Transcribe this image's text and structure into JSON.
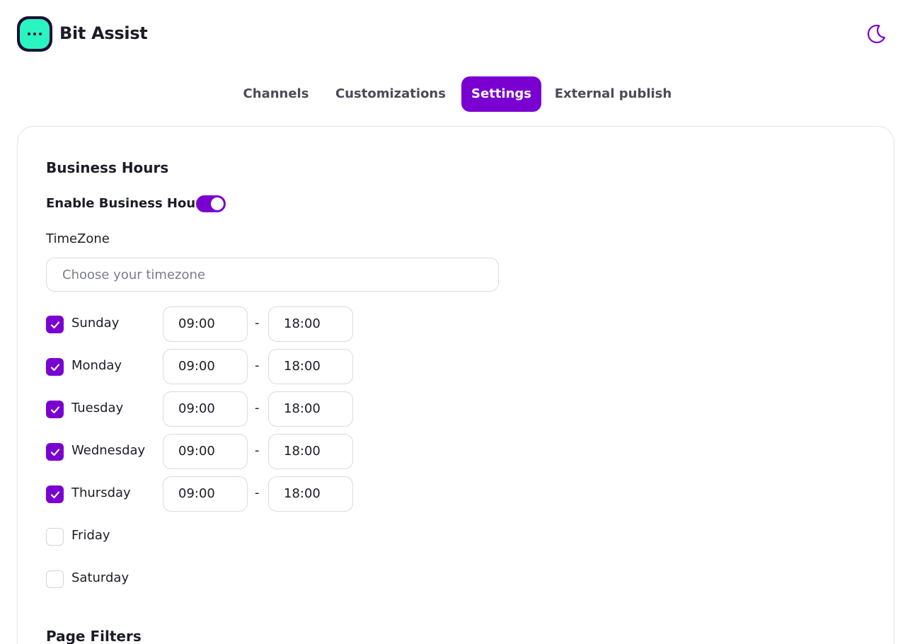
{
  "app": {
    "title": "Bit Assist"
  },
  "header": {
    "theme_icon": "moon-icon"
  },
  "tabs": [
    {
      "label": "Channels",
      "active": false
    },
    {
      "label": "Customizations",
      "active": false
    },
    {
      "label": "Settings",
      "active": true
    },
    {
      "label": "External publish",
      "active": false
    }
  ],
  "business_hours": {
    "title": "Business Hours",
    "enable_label": "Enable Business Hours",
    "enabled": true,
    "timezone_label": "TimeZone",
    "timezone_placeholder": "Choose your timezone",
    "timezone_value": "",
    "separator": "-",
    "days": [
      {
        "name": "Sunday",
        "checked": true,
        "start": "09:00",
        "end": "18:00"
      },
      {
        "name": "Monday",
        "checked": true,
        "start": "09:00",
        "end": "18:00"
      },
      {
        "name": "Tuesday",
        "checked": true,
        "start": "09:00",
        "end": "18:00"
      },
      {
        "name": "Wednesday",
        "checked": true,
        "start": "09:00",
        "end": "18:00"
      },
      {
        "name": "Thursday",
        "checked": true,
        "start": "09:00",
        "end": "18:00"
      },
      {
        "name": "Friday",
        "checked": false,
        "start": "",
        "end": ""
      },
      {
        "name": "Saturday",
        "checked": false,
        "start": "",
        "end": ""
      }
    ]
  },
  "page_filters": {
    "title": "Page Filters"
  },
  "colors": {
    "accent": "#7a00d1",
    "logo_bg": "#2af5c0",
    "logo_border": "#1a1036"
  }
}
